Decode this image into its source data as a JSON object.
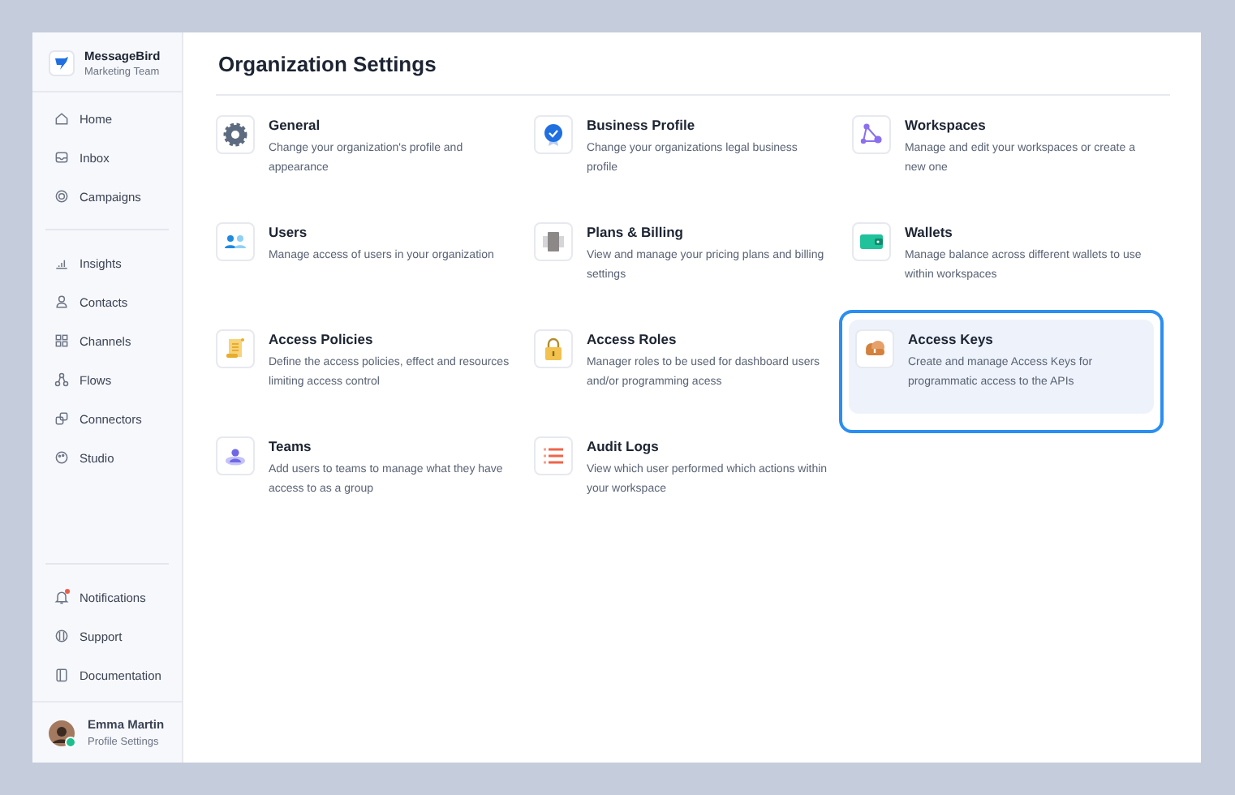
{
  "sidebar": {
    "brand": {
      "name": "MessageBird",
      "team": "Marketing Team"
    },
    "groups": [
      [
        {
          "label": "Home",
          "badge": false
        },
        {
          "label": "Inbox",
          "badge": false
        },
        {
          "label": "Campaigns",
          "badge": false
        }
      ],
      [
        {
          "label": "Insights",
          "badge": false
        },
        {
          "label": "Contacts",
          "badge": false
        },
        {
          "label": "Channels",
          "badge": false
        },
        {
          "label": "Flows",
          "badge": false
        },
        {
          "label": "Connectors",
          "badge": false
        },
        {
          "label": "Studio",
          "badge": false
        }
      ],
      [
        {
          "label": "Notifications",
          "badge": true
        },
        {
          "label": "Support",
          "badge": false
        },
        {
          "label": "Documentation",
          "badge": false
        }
      ]
    ],
    "user": {
      "name": "Emma Martin",
      "subtitle": "Profile Settings",
      "online": true
    }
  },
  "page": {
    "title": "Organization Settings",
    "cards": [
      {
        "title": "General",
        "description": "Change your organization's profile and appearance",
        "selected": false
      },
      {
        "title": "Business Profile",
        "description": "Change your organizations legal business profile",
        "selected": false
      },
      {
        "title": "Workspaces",
        "description": "Manage and edit your workspaces or create a new one",
        "selected": false
      },
      {
        "title": "Users",
        "description": "Manage access of users in your organization",
        "selected": false
      },
      {
        "title": "Plans & Billing",
        "description": "View and manage your pricing plans and billing settings",
        "selected": false
      },
      {
        "title": "Wallets",
        "description": "Manage balance across different wallets to use within workspaces",
        "selected": false
      },
      {
        "title": "Access Policies",
        "description": "Define the access policies, effect and resources limiting access control",
        "selected": false
      },
      {
        "title": "Access Roles",
        "description": "Manager roles to be used for dashboard users and/or programming acess",
        "selected": false
      },
      {
        "title": "Access Keys",
        "description": "Create and manage Access Keys for programmatic access to the APIs",
        "selected": true
      },
      {
        "title": "Teams",
        "description": "Add users to teams to manage what they have access to as a group",
        "selected": false
      },
      {
        "title": "Audit Logs",
        "description": "View which user performed which actions within your workspace",
        "selected": false
      }
    ]
  }
}
